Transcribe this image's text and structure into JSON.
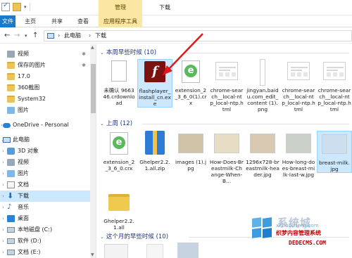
{
  "window": {
    "title": "下载",
    "context_tab_header": "管理"
  },
  "ribbon": {
    "tabs": [
      {
        "label": "文件"
      },
      {
        "label": "主页"
      },
      {
        "label": "共享"
      },
      {
        "label": "查看"
      },
      {
        "label": "应用程序工具"
      }
    ]
  },
  "address": {
    "crumbs": [
      "›",
      "此电脑",
      "›",
      "下载"
    ]
  },
  "sidebar": {
    "items": [
      {
        "label": "视频",
        "icon": "video-folder-icon"
      },
      {
        "label": "保存的图片",
        "icon": "folder-icon"
      },
      {
        "label": "17.0",
        "icon": "folder-icon"
      },
      {
        "label": "360截图",
        "icon": "folder-icon"
      },
      {
        "label": "System32",
        "icon": "folder-icon"
      },
      {
        "label": "图片",
        "icon": "pictures-folder-icon"
      },
      {
        "label": "OneDrive - Personal",
        "icon": "onedrive-icon"
      },
      {
        "label": "此电脑",
        "icon": "this-pc-icon"
      },
      {
        "label": "3D 对象",
        "icon": "3d-objects-icon"
      },
      {
        "label": "视频",
        "icon": "video-folder-icon"
      },
      {
        "label": "图片",
        "icon": "pictures-folder-icon"
      },
      {
        "label": "文档",
        "icon": "documents-icon"
      },
      {
        "label": "下载",
        "icon": "download-icon"
      },
      {
        "label": "音乐",
        "icon": "music-icon"
      },
      {
        "label": "桌面",
        "icon": "desktop-icon"
      },
      {
        "label": "本地磁盘 (C:)",
        "icon": "drive-icon"
      },
      {
        "label": "软件 (D:)",
        "icon": "drive-icon"
      },
      {
        "label": "文档 (E:)",
        "icon": "drive-icon"
      }
    ]
  },
  "groups": {
    "week": "本周早些时候 (10)",
    "lastweek": "上周 (12)",
    "month": "这个月的早些时候 (10)"
  },
  "files_week": [
    {
      "name": "未确认 966346.crdownload",
      "kind": "doc"
    },
    {
      "name": "flashplayer_install_cn.exe",
      "kind": "flash",
      "selected": true
    },
    {
      "name": "extension_2_3_6_0(1).crx",
      "kind": "crx"
    },
    {
      "name": "chrome-search__local-ntp_local-ntp.html",
      "kind": "png"
    },
    {
      "name": "jingyan.baidu.com_edit_content (1).png",
      "kind": "tall"
    },
    {
      "name": "chrome-search__local-ntp_local-ntp.html",
      "kind": "png"
    },
    {
      "name": "chrome-search__local-ntp_local-ntp.html",
      "kind": "png"
    }
  ],
  "files_lastweek": [
    {
      "name": "extension_2_3_6_0.crx",
      "kind": "crx"
    },
    {
      "name": "Ghelper2.2.1.all.zip",
      "kind": "zip"
    },
    {
      "name": "images (1).jpg",
      "kind": "photo",
      "color": "#cfc2a6"
    },
    {
      "name": "How-Does-Breastmilk-Change-When-B...",
      "kind": "photo",
      "color": "#e7dcc4"
    },
    {
      "name": "1296x728-breastmilk-header.jpg",
      "kind": "photo",
      "color": "#d9c9b3"
    },
    {
      "name": "How-long-does-breast-milk-last-w.jpg",
      "kind": "photo",
      "color": "#c8d0c8"
    },
    {
      "name": "breast-milk.jpg",
      "kind": "photo",
      "color": "#cddfee",
      "selected": true
    },
    {
      "name": "Ghelper2.2.1.all",
      "kind": "folder"
    }
  ],
  "watermark": {
    "title": "系统城",
    "sub": "xitongcheng.com",
    "cn": "织梦内容管理系统",
    "url": "DEDECMS.COM"
  }
}
